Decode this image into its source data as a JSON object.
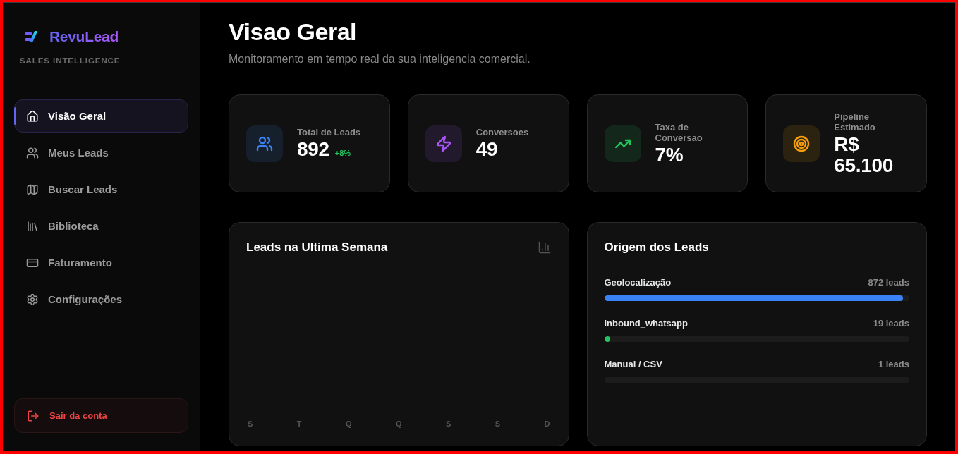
{
  "sidebar": {
    "brand": "RevuLead",
    "tagline": "SALES INTELLIGENCE",
    "nav": [
      {
        "label": "Visão Geral",
        "selected": true
      },
      {
        "label": "Meus Leads",
        "selected": false
      },
      {
        "label": "Buscar Leads",
        "selected": false
      },
      {
        "label": "Biblioteca",
        "selected": false
      },
      {
        "label": "Faturamento",
        "selected": false
      },
      {
        "label": "Configurações",
        "selected": false
      }
    ],
    "logout": "Sair da conta"
  },
  "header": {
    "title": "Visao Geral",
    "subtitle": "Monitoramento em tempo real da sua inteligencia comercial."
  },
  "stats": [
    {
      "label": "Total de Leads",
      "value": "892",
      "change": "+8%",
      "color": "#3b82f6"
    },
    {
      "label": "Conversoes",
      "value": "49",
      "color": "#a855f7"
    },
    {
      "label": "Taxa de Conversao",
      "value": "7%",
      "color": "#22c55e"
    },
    {
      "label": "Pipeline Estimado",
      "value": "R$ 65.100",
      "color": "#f59e0b"
    }
  ],
  "weekly_chart": {
    "title": "Leads na Ultima Semana",
    "day_labels": [
      "S",
      "T",
      "Q",
      "Q",
      "S",
      "S",
      "D"
    ]
  },
  "lead_sources": {
    "title": "Origem dos Leads",
    "items": [
      {
        "name": "Geolocalização",
        "count": "872 leads",
        "level": 0.98,
        "color": "#3b82f6"
      },
      {
        "name": "inbound_whatsapp",
        "count": "19 leads",
        "level": 0.02,
        "color": "#22c55e"
      },
      {
        "name": "Manual / CSV",
        "count": "1 leads"
      }
    ]
  }
}
